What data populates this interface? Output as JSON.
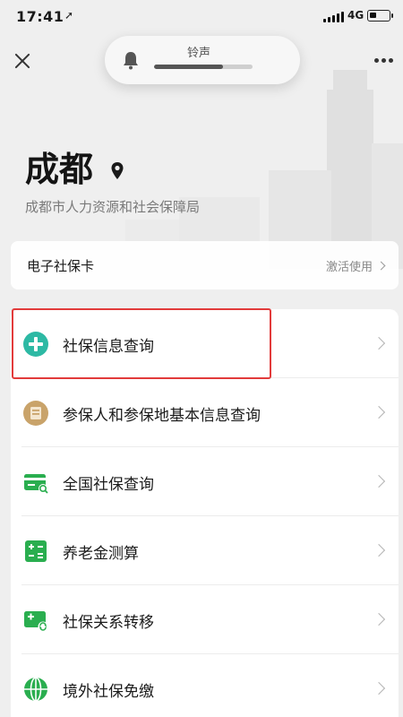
{
  "status_bar": {
    "time": "17:41",
    "network": "4G",
    "battery_level": 0.35
  },
  "volume_hud": {
    "label": "铃声",
    "level": 0.7
  },
  "header": {
    "city": "成都",
    "bureau": "成都市人力资源和社会保障局"
  },
  "card_row": {
    "label": "电子社保卡",
    "action": "激活使用"
  },
  "menu": {
    "items": [
      {
        "label": "社保信息查询",
        "icon": "plus-circle-icon",
        "color": "#2db9a4"
      },
      {
        "label": "参保人和参保地基本信息查询",
        "icon": "id-card-icon",
        "color": "#c9a36a"
      },
      {
        "label": "全国社保查询",
        "icon": "card-search-icon",
        "color": "#2aae4f"
      },
      {
        "label": "养老金测算",
        "icon": "calculator-icon",
        "color": "#2aae4f"
      },
      {
        "label": "社保关系转移",
        "icon": "card-transfer-icon",
        "color": "#2aae4f"
      },
      {
        "label": "境外社保免缴",
        "icon": "globe-icon",
        "color": "#2aae4f"
      }
    ]
  },
  "highlight_color": "#e23b3b"
}
